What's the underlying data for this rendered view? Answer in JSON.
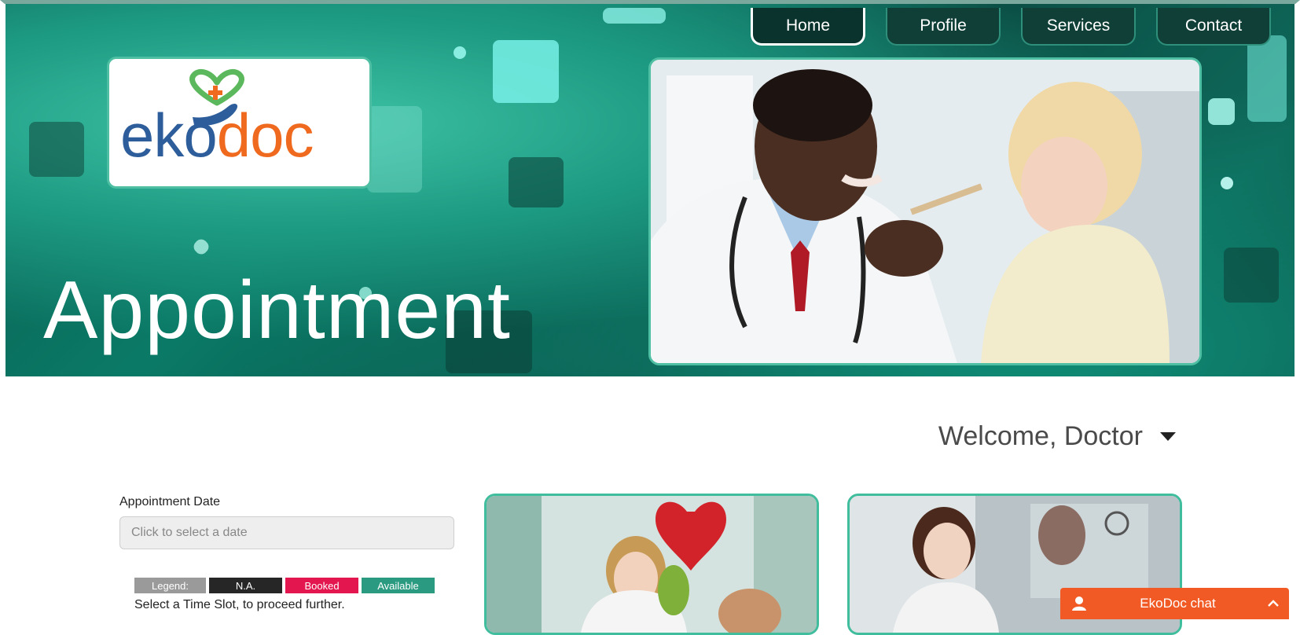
{
  "nav": {
    "items": [
      {
        "label": "Home",
        "active": true
      },
      {
        "label": "Profile",
        "active": false
      },
      {
        "label": "Services",
        "active": false
      },
      {
        "label": "Contact",
        "active": false
      }
    ]
  },
  "brand": {
    "logo_e": "e",
    "logo_k": "k",
    "logo_o": "o",
    "logo_doc": "doc",
    "color_blue": "#2d5d9a",
    "color_orange": "#ef6a1f",
    "color_green": "#5cb85c"
  },
  "hero": {
    "title": "Appointment",
    "photo_icon": "doctor-with-child-photo"
  },
  "user": {
    "welcome": "Welcome, Doctor"
  },
  "appointment": {
    "date_label": "Appointment Date",
    "date_placeholder": "Click to select a date",
    "legend": {
      "label": "Legend:",
      "na": "N.A.",
      "booked": "Booked",
      "available": "Available"
    },
    "hint": "Select a Time Slot, to proceed further."
  },
  "cards": [
    {
      "icon": "nurse-child-balloon-photo"
    },
    {
      "icon": "nurse-sink-photo"
    }
  ],
  "chat": {
    "title": "EkoDoc chat",
    "accent": "#f15a24"
  },
  "theme": {
    "teal": "#3fbd9d",
    "dark_teal": "#0b4f46"
  }
}
